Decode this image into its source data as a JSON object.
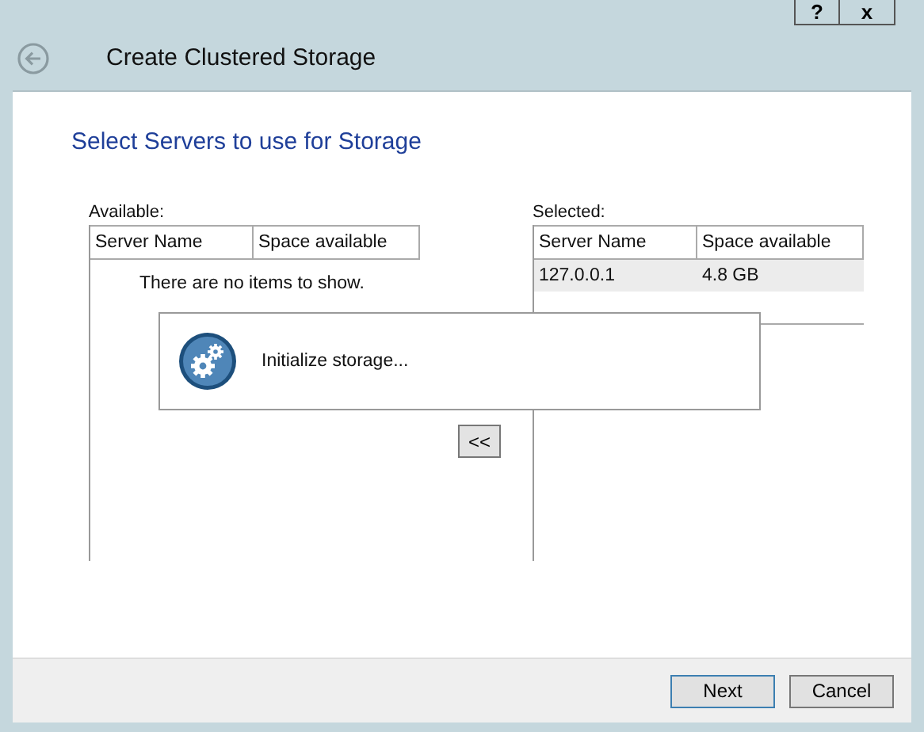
{
  "window": {
    "title_bar_buttons": [
      "?",
      "x"
    ],
    "title": "Create Clustered Storage"
  },
  "heading": "Select Servers to use for Storage",
  "available": {
    "label": "Available:",
    "columns": [
      "Server Name",
      "Space available"
    ],
    "empty_message": "There are no items to show."
  },
  "move_button": "<<",
  "selected_list": {
    "label": "Selected:",
    "columns": [
      "Server Name",
      "Space available"
    ],
    "rows": [
      {
        "server_name": "127.0.0.1",
        "space_available": "4.8 GB",
        "selected": true
      }
    ]
  },
  "progress_dialog": {
    "message": "Initialize storage..."
  },
  "buttons": [
    {
      "label": "Next",
      "default": true
    },
    {
      "label": "Cancel",
      "default": false
    }
  ]
}
